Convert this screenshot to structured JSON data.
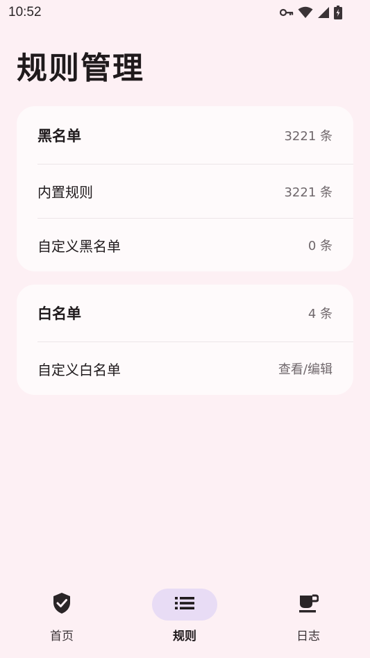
{
  "status_bar": {
    "time": "10:52",
    "icons": [
      "key-icon",
      "wifi-icon",
      "cellular-icon",
      "battery-charging-icon"
    ]
  },
  "page": {
    "title": "规则管理"
  },
  "blacklist_card": {
    "header": {
      "label": "黑名单",
      "value": "3221 条"
    },
    "items": [
      {
        "label": "内置规则",
        "value": "3221 条"
      },
      {
        "label": "自定义黑名单",
        "value": "0 条"
      }
    ]
  },
  "whitelist_card": {
    "header": {
      "label": "白名单",
      "value": "4 条"
    },
    "items": [
      {
        "label": "自定义白名单",
        "value": "查看/编辑"
      }
    ]
  },
  "bottom_nav": {
    "items": [
      {
        "label": "首页",
        "icon": "shield-check-icon",
        "active": false
      },
      {
        "label": "规则",
        "icon": "list-icon",
        "active": true
      },
      {
        "label": "日志",
        "icon": "coffee-cup-icon",
        "active": false
      }
    ]
  },
  "colors": {
    "background": "#fdf0f4",
    "card": "#fefafb",
    "active_indicator": "#e8dcf5",
    "text_primary": "#1f1a1c",
    "text_secondary": "#6f676b"
  }
}
